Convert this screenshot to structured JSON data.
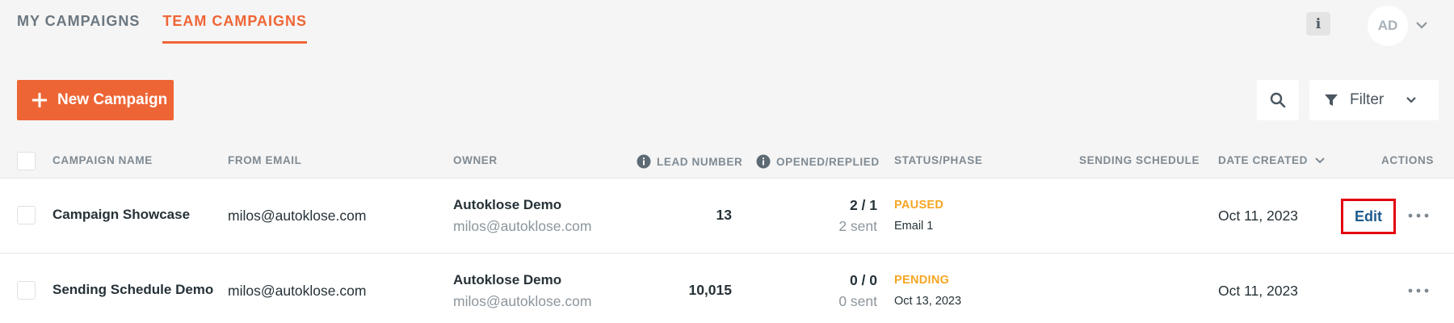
{
  "tabs": [
    "MY CAMPAIGNS",
    "TEAM CAMPAIGNS"
  ],
  "header": {
    "info_icon": "i",
    "avatar_initials": "AD"
  },
  "toolbar": {
    "new_campaign": "New Campaign",
    "filter": "Filter"
  },
  "columns": {
    "campaign_name": "CAMPAIGN NAME",
    "from_email": "FROM EMAIL",
    "owner": "OWNER",
    "lead_number": "LEAD NUMBER",
    "opened_replied": "OPENED/REPLIED",
    "status_phase": "STATUS/PHASE",
    "sending_schedule": "SENDING SCHEDULE",
    "date_created": "DATE CREATED",
    "actions": "ACTIONS"
  },
  "rows": [
    {
      "name": "Campaign Showcase",
      "from_email": "milos@autoklose.com",
      "owner_name": "Autoklose Demo",
      "owner_email": "milos@autoklose.com",
      "leads": "13",
      "opened_replied": "2 / 1",
      "sent": "2 sent",
      "status": "PAUSED",
      "phase": "Email 1",
      "date_created": "Oct 11, 2023",
      "edit": "Edit"
    },
    {
      "name": "Sending Schedule Demo",
      "from_email": "milos@autoklose.com",
      "owner_name": "Autoklose Demo",
      "owner_email": "milos@autoklose.com",
      "leads": "10,015",
      "opened_replied": "0 / 0",
      "sent": "0 sent",
      "status": "PENDING",
      "phase": "Oct 13, 2023",
      "date_created": "Oct 11, 2023"
    }
  ],
  "colors": {
    "accent": "#ee6535",
    "status_paused": "#f5a623",
    "status_pending": "#f5a623",
    "edit_highlight": "#e3000f"
  },
  "icons": [
    "info-icon",
    "chevron-down-icon",
    "plus-icon",
    "search-icon",
    "filter-icon",
    "sort-down-icon",
    "more-horizontal-icon"
  ]
}
